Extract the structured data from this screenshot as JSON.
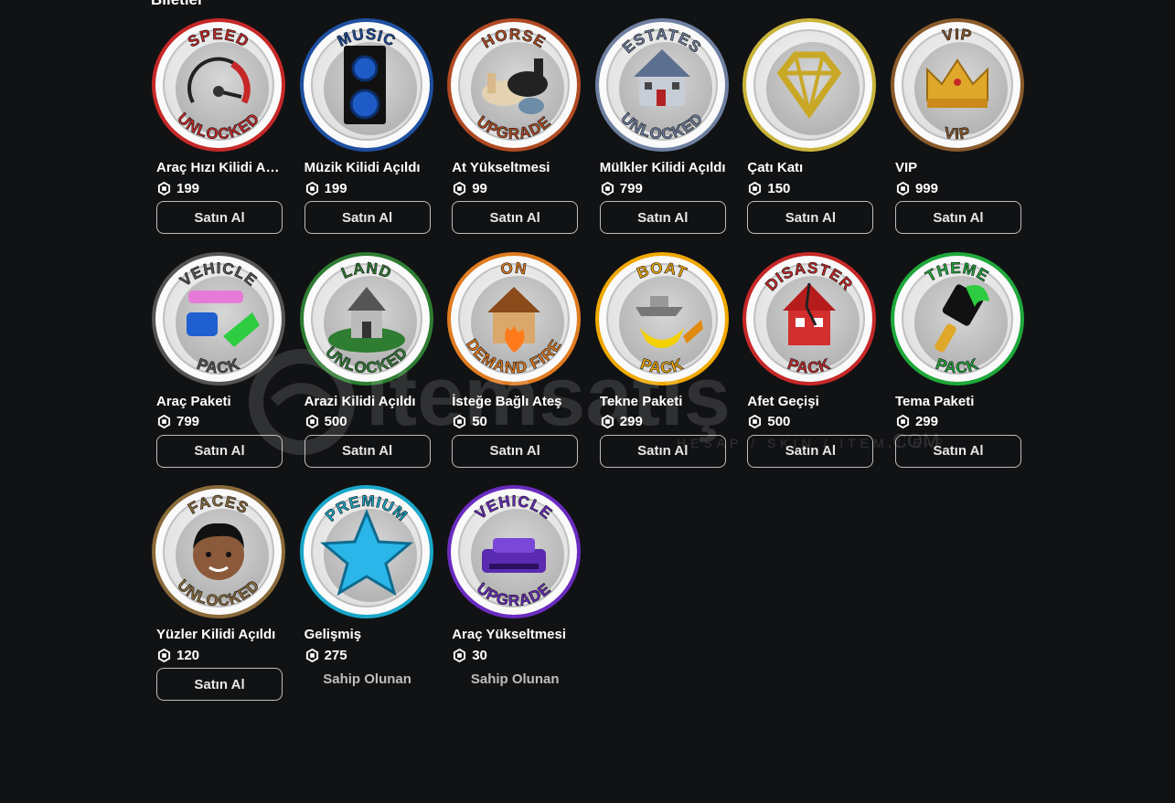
{
  "section_title": "Biletler",
  "watermark": {
    "text": "itemsatış",
    "tagline": "HESAP / SKIN / ITEM / E-PIN",
    "suffix": ".COM"
  },
  "items": [
    {
      "name": "Araç Hızı Kilidi Aç...",
      "price": "199",
      "action": "Satın Al",
      "owned": false,
      "badge": {
        "top": "SPEED",
        "bottom": "UNLOCKED",
        "ring": "#c62828",
        "icon": "speedometer-icon"
      }
    },
    {
      "name": "Müzik Kilidi Açıldı",
      "price": "199",
      "action": "Satın Al",
      "owned": false,
      "badge": {
        "top": "MUSIC",
        "bottom": "",
        "ring": "#1e4fa0",
        "icon": "speaker-icon"
      }
    },
    {
      "name": "At Yükseltmesi",
      "price": "99",
      "action": "Satın Al",
      "owned": false,
      "badge": {
        "top": "HORSE",
        "bottom": "UPGRADE",
        "ring": "#b04a22",
        "icon": "horse-icon"
      }
    },
    {
      "name": "Mülkler Kilidi Açıldı",
      "price": "799",
      "action": "Satın Al",
      "owned": false,
      "badge": {
        "top": "ESTATES",
        "bottom": "UNLOCKED",
        "ring": "#6e7fa0",
        "icon": "house-icon"
      }
    },
    {
      "name": "Çatı Katı",
      "price": "150",
      "action": "Satın Al",
      "owned": false,
      "badge": {
        "top": "",
        "bottom": "",
        "ring": "#c9b43a",
        "icon": "diamond-icon"
      }
    },
    {
      "name": "VIP",
      "price": "999",
      "action": "Satın Al",
      "owned": false,
      "badge": {
        "top": "VIP",
        "bottom": "VIP",
        "ring": "#8a5a2a",
        "icon": "crown-icon"
      }
    },
    {
      "name": "Araç Paketi",
      "price": "799",
      "action": "Satın Al",
      "owned": false,
      "badge": {
        "top": "VEHICLE",
        "bottom": "PACK",
        "ring": "#555555",
        "icon": "cars-icon"
      }
    },
    {
      "name": "Arazi Kilidi Açıldı",
      "price": "500",
      "action": "Satın Al",
      "owned": false,
      "badge": {
        "top": "LAND",
        "bottom": "UNLOCKED",
        "ring": "#2e7d32",
        "icon": "land-house-icon"
      }
    },
    {
      "name": "İsteğe Bağlı Ateş",
      "price": "50",
      "action": "Satın Al",
      "owned": false,
      "badge": {
        "top": "ON",
        "bottom": "DEMAND FIRE",
        "ring": "#e07b20",
        "icon": "fire-house-icon"
      }
    },
    {
      "name": "Tekne Paketi",
      "price": "299",
      "action": "Satın Al",
      "owned": false,
      "badge": {
        "top": "BOAT",
        "bottom": "PACK",
        "ring": "#f0a800",
        "icon": "boat-icon"
      }
    },
    {
      "name": "Afet Geçişi",
      "price": "500",
      "action": "Satın Al",
      "owned": false,
      "badge": {
        "top": "DISASTER",
        "bottom": "PACK",
        "ring": "#c62828",
        "icon": "broken-house-icon"
      }
    },
    {
      "name": "Tema Paketi",
      "price": "299",
      "action": "Satın Al",
      "owned": false,
      "badge": {
        "top": "THEME",
        "bottom": "PACK",
        "ring": "#1fa83a",
        "icon": "paintbrush-icon"
      }
    },
    {
      "name": "Yüzler Kilidi Açıldı",
      "price": "120",
      "action": "Satın Al",
      "owned": false,
      "badge": {
        "top": "FACES",
        "bottom": "UNLOCKED",
        "ring": "#8a6a3a",
        "icon": "face-icon"
      }
    },
    {
      "name": "Gelişmiş",
      "price": "275",
      "action": "Sahip Olunan",
      "owned": true,
      "badge": {
        "top": "PREMIUM",
        "bottom": "",
        "ring": "#1aa7c9",
        "icon": "star-icon"
      }
    },
    {
      "name": "Araç Yükseltmesi",
      "price": "30",
      "action": "Sahip Olunan",
      "owned": true,
      "badge": {
        "top": "VEHICLE",
        "bottom": "UPGRADE",
        "ring": "#6a2bbf",
        "icon": "purple-car-icon"
      }
    }
  ]
}
